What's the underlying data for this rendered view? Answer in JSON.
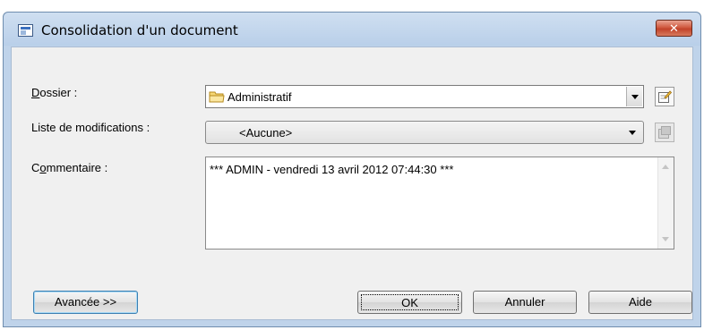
{
  "window": {
    "title": "Consolidation d'un document",
    "close_label": "✕"
  },
  "form": {
    "folder": {
      "label_access": "D",
      "label_rest": "ossier :",
      "value": "Administratif"
    },
    "changelist": {
      "label": "Liste de modifications :",
      "value": "<Aucune>"
    },
    "comment": {
      "label_pre": "C",
      "label_access": "o",
      "label_rest": "mmentaire :",
      "value": "*** ADMIN - vendredi 13 avril 2012 07:44:30 ***"
    }
  },
  "buttons": {
    "advanced": "Avancée >>",
    "ok": "OK",
    "cancel": "Annuler",
    "help": "Aide"
  },
  "icons": {
    "app": "dialog-app-icon",
    "folder": "folder-icon",
    "properties": "properties-icon",
    "properties_disabled": "properties-icon-disabled"
  }
}
